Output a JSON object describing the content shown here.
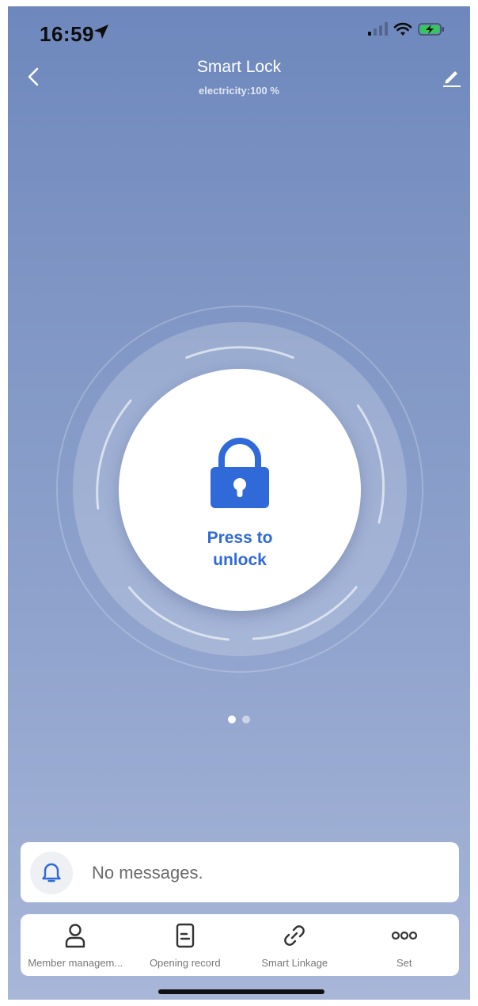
{
  "status_bar": {
    "time": "16:59"
  },
  "header": {
    "title": "Smart Lock",
    "subtitle": "electricity:100 %"
  },
  "unlock_button": {
    "label": "Press to\nunlock"
  },
  "pager": {
    "page_count": 2,
    "active_index": 0
  },
  "messages": {
    "text": "No messages."
  },
  "toolbar": {
    "items": [
      {
        "label": "Member managem...",
        "icon": "person-icon"
      },
      {
        "label": "Opening record",
        "icon": "document-icon"
      },
      {
        "label": "Smart Linkage",
        "icon": "link-icon"
      },
      {
        "label": "Set",
        "icon": "more-dots-icon"
      }
    ]
  },
  "colors": {
    "accent": "#2f6ad8",
    "background_top": "#6e88bd",
    "background_bottom": "#a8b6d8"
  }
}
